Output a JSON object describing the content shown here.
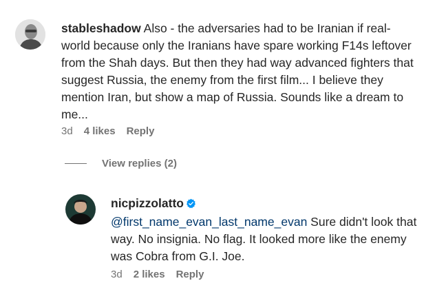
{
  "comment1": {
    "username": "stableshadow",
    "text": "Also - the adversaries had to be Iranian if real-world because only the Iranians have spare working F14s leftover from the Shah days. But then they had way advanced fighters that suggest Russia, the enemy from the first film... I believe they mention Iran, but show a map of Russia. Sounds like a dream to me...",
    "time": "3d",
    "likes": "4 likes",
    "reply_label": "Reply"
  },
  "view_replies": "View replies (2)",
  "reply1": {
    "username": "nicpizzolatto",
    "mention": "@first_name_evan_last_name_evan",
    "text": " Sure didn't look that way. No insignia. No flag. It looked more like the enemy was Cobra from G.I. Joe.",
    "time": "3d",
    "likes": "2 likes",
    "reply_label": "Reply"
  },
  "colors": {
    "text": "#262626",
    "secondary": "#737373",
    "mention": "#00376b",
    "verified": "#0095f6"
  }
}
